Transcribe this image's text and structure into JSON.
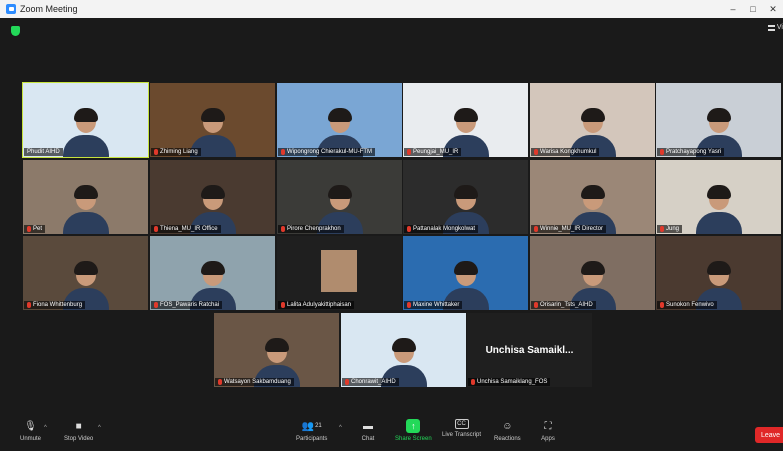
{
  "window": {
    "title": "Zoom Meeting",
    "controls": [
      "–",
      "□",
      "✕"
    ]
  },
  "view_label": "Vi",
  "participants": [
    {
      "name": "Phudit AIHD",
      "bg": "#d9e7f2",
      "muted": false,
      "active": true
    },
    {
      "name": "Zhiming Liang",
      "bg": "#6b4a2e",
      "muted": true
    },
    {
      "name": "Wipongrong Chierakul-MU-FTM",
      "bg": "#7aa6d4",
      "muted": true
    },
    {
      "name": "Peungjai_MU_IR",
      "bg": "#e9ecef",
      "muted": true
    },
    {
      "name": "Warisa Kongkhumkul",
      "bg": "#d3c6bb",
      "muted": true
    },
    {
      "name": "Pratchayapong Yasri",
      "bg": "#c9cfd6",
      "muted": true
    },
    {
      "name": "Pet",
      "bg": "#8c7a6a",
      "muted": true
    },
    {
      "name": "Thiena_MU_IR Office",
      "bg": "#4a3a30",
      "muted": true
    },
    {
      "name": "Pirore Chenprakhon",
      "bg": "#3b3b38",
      "muted": true
    },
    {
      "name": "Pattanalak Mongkolwat",
      "bg": "#2c2c2c",
      "muted": true
    },
    {
      "name": "Winnie_MU_IR Director",
      "bg": "#9b8777",
      "muted": true
    },
    {
      "name": "Jung",
      "bg": "#d6d0c6",
      "muted": true
    },
    {
      "name": "Fiona Whittenburg",
      "bg": "#5a4a3c",
      "muted": true
    },
    {
      "name": "FOS_Pawaris Ratchai",
      "bg": "#8fa3ad",
      "muted": true
    },
    {
      "name": "Lalita Adulyakittiphaisan",
      "bg": "#1f1f1f",
      "muted": true
    },
    {
      "name": "Maxine Whittaker",
      "bg": "#2b6cb0",
      "muted": true
    },
    {
      "name": "Orisarin_Tsts_AIHD",
      "bg": "#7f6e62",
      "muted": true
    },
    {
      "name": "Sunokon Fenwivo",
      "bg": "#4b3a30",
      "muted": true
    },
    {
      "name": "Watsayon Sakbamduang",
      "bg": "#6a5646",
      "muted": true
    },
    {
      "name": "Chonrawit_AIHD",
      "bg": "#d9e7f2",
      "muted": true
    },
    {
      "name": "Unchisa Samaiklang_FOS",
      "bg": "#1f1f1f",
      "muted": true,
      "display_name": "Unchisa Samaikl..."
    }
  ],
  "toolbar": {
    "unmute": "Unmute",
    "stop_video": "Stop Video",
    "participants": "Participants",
    "participants_count": "21",
    "chat": "Chat",
    "share_screen": "Share Screen",
    "live_transcript": "Live Transcript",
    "reactions": "Reactions",
    "apps": "Apps",
    "leave": "Leave"
  },
  "colors": {
    "accent_green": "#23d959",
    "active_speaker": "#c7e33d",
    "leave_red": "#e02828",
    "zoom_blue": "#2d8cff"
  }
}
